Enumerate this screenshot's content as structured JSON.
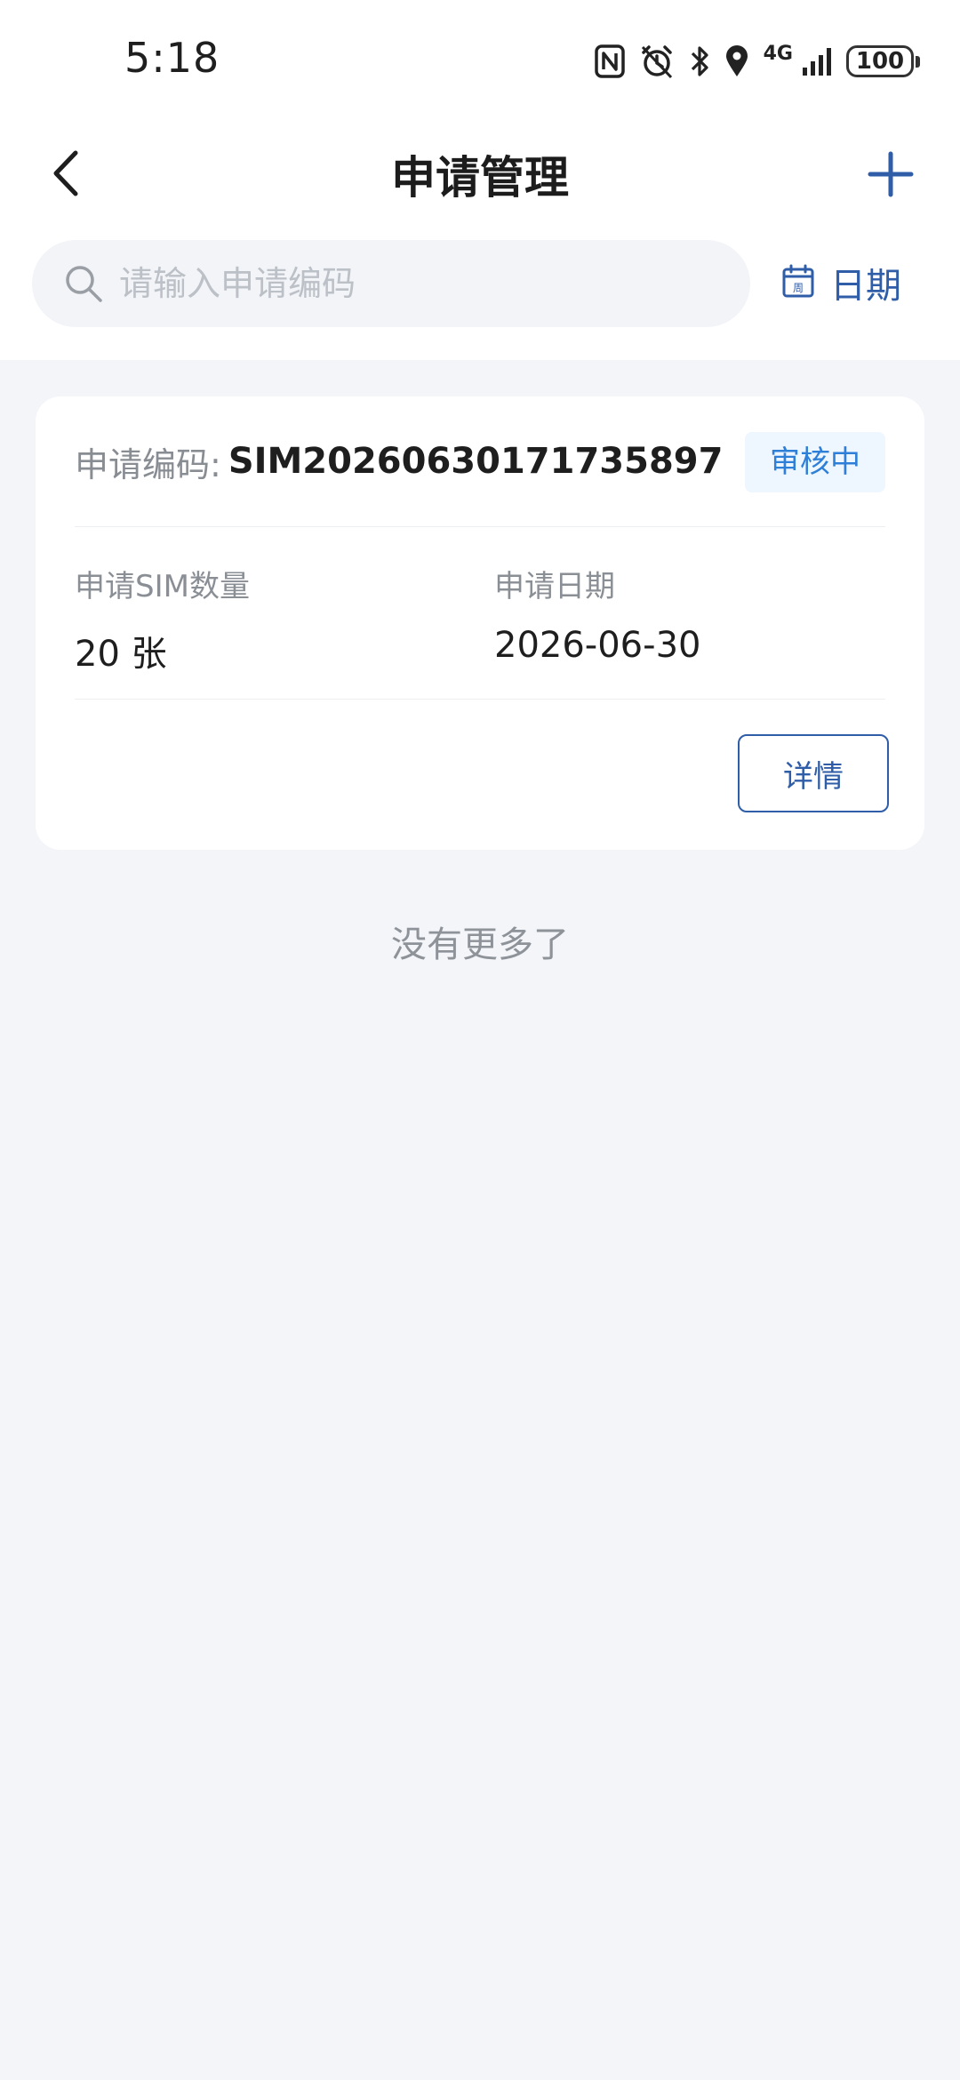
{
  "status_bar": {
    "time": "5:18",
    "network": "4G",
    "battery": "100",
    "icons": [
      "nfc-icon",
      "alarm-icon",
      "bluetooth-icon",
      "location-icon",
      "signal-icon",
      "battery-icon"
    ]
  },
  "header": {
    "title": "申请管理",
    "back_icon": "chevron-left-icon",
    "add_icon": "plus-icon"
  },
  "search": {
    "placeholder": "请输入申请编码",
    "value": "",
    "date_label": "日期",
    "date_icon_text": "周"
  },
  "applications": [
    {
      "code_label": "申请编码:",
      "code": "SIM20260630171735897",
      "status": "审核中",
      "quantity_label": "申请SIM数量",
      "quantity": "20 张",
      "date_label": "申请日期",
      "date": "2026-06-30",
      "detail_label": "详情"
    }
  ],
  "list_footer": "没有更多了",
  "colors": {
    "accent": "#2f5da8",
    "badge_text": "#2e7fd8",
    "badge_bg": "#eef6ff",
    "page_bg": "#f3f5f9"
  }
}
